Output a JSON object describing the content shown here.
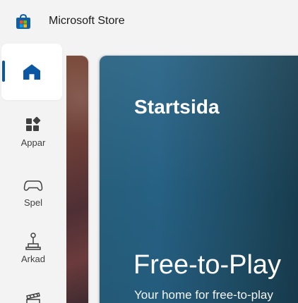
{
  "app": {
    "title": "Microsoft Store"
  },
  "icons": {
    "store": "microsoft-store-icon",
    "home": "home-icon",
    "apps": "apps-icon",
    "games": "gamepad-icon",
    "arcade": "joystick-icon",
    "movies": "clapperboard-icon"
  },
  "nav": {
    "items": [
      {
        "label": ""
      },
      {
        "label": "Appar"
      },
      {
        "label": "Spel"
      },
      {
        "label": "Arkad"
      },
      {
        "label": ""
      }
    ]
  },
  "main": {
    "heading": "Startsida"
  },
  "hero": {
    "title": "Free-to-Play",
    "subtitle": "Your home for free-to-play"
  },
  "colors": {
    "accent": "#0b57a4",
    "window_background": "#f3f3f3",
    "hero_left": "#27617f",
    "hero_right": "#173a4c"
  }
}
